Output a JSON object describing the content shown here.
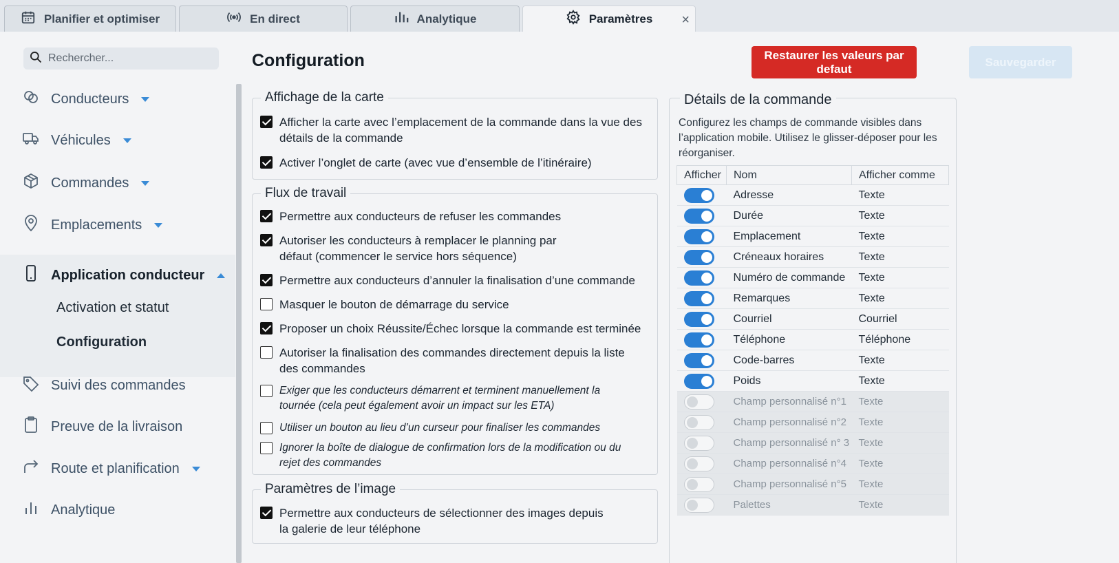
{
  "tabs": [
    {
      "label": "Planifier et optimiser",
      "icon": "calendar-icon"
    },
    {
      "label": "En direct",
      "icon": "broadcast-icon"
    },
    {
      "label": "Analytique",
      "icon": "bar-chart-icon"
    },
    {
      "label": "Paramètres",
      "icon": "gear-icon",
      "active": true
    }
  ],
  "tab_close": "×",
  "search": {
    "placeholder": "Rechercher..."
  },
  "sidebar": {
    "items": [
      {
        "label": "Conducteurs",
        "icon": "drivers-icon"
      },
      {
        "label": "Véhicules",
        "icon": "truck-icon"
      },
      {
        "label": "Commandes",
        "icon": "package-icon"
      },
      {
        "label": "Emplacements",
        "icon": "location-pin-icon"
      },
      {
        "label": "Application conducteur",
        "icon": "mobile-phone-icon"
      },
      {
        "label": "Suivi des commandes",
        "icon": "tag-icon"
      },
      {
        "label": "Preuve de la livraison",
        "icon": "clipboard-icon"
      },
      {
        "label": "Route et planification",
        "icon": "route-arrow-icon"
      },
      {
        "label": "Analytique",
        "icon": "analytics-icon"
      }
    ],
    "subitems": [
      {
        "label": "Activation et statut"
      },
      {
        "label": "Configuration",
        "active": true
      }
    ]
  },
  "page": {
    "title": "Configuration",
    "reset_label": "Restaurer les valeurs par defaut",
    "save_label": "Sauvegarder"
  },
  "map_display": {
    "legend": "Affichage de la carte",
    "options": [
      {
        "label": "Afficher la carte avec l’emplacement de la commande dans la vue des détails de la commande",
        "checked": true
      },
      {
        "label": "Activer l’onglet de carte (avec vue d’ensemble de l’itinéraire)",
        "checked": true
      }
    ]
  },
  "workflow": {
    "legend": "Flux de travail",
    "options": [
      {
        "label": "Permettre aux conducteurs de refuser les commandes",
        "checked": true
      },
      {
        "label": "Autoriser les conducteurs à remplacer le planning par défaut (commencer le service hors séquence)",
        "checked": true
      },
      {
        "label": "Permettre aux conducteurs d’annuler la finalisation d’une commande",
        "checked": true
      },
      {
        "label": "Masquer le bouton de démarrage du service",
        "checked": false
      },
      {
        "label": "Proposer un choix Réussite/Échec lorsque la commande est terminée",
        "checked": true
      },
      {
        "label": "Autoriser la finalisation des commandes directement depuis la liste des commandes",
        "checked": false
      },
      {
        "label": "Exiger que les conducteurs démarrent et terminent manuellement la tournée (cela peut également avoir un impact sur les ETA)",
        "checked": false
      },
      {
        "label": "Utiliser un bouton au lieu d’un curseur pour finaliser les commandes",
        "checked": false
      },
      {
        "label": "Ignorer la boîte de dialogue de confirmation lors de la modification ou du rejet des commandes",
        "checked": false
      }
    ]
  },
  "image_settings": {
    "legend": "Paramètres de l’image",
    "options": [
      {
        "label": "Permettre aux conducteurs de sélectionner des images depuis la galerie de leur téléphone",
        "checked": true
      }
    ]
  },
  "order_details": {
    "title": "Détails de la commande",
    "description": "Configurez les champs de commande visibles dans l’application mobile. Utilisez le glisser-déposer pour les réorganiser.",
    "columns": [
      "Afficher",
      "Nom",
      "Afficher comme"
    ],
    "rows": [
      {
        "show": true,
        "name": "Adresse",
        "as": "Texte"
      },
      {
        "show": true,
        "name": "Durée",
        "as": "Texte"
      },
      {
        "show": true,
        "name": "Emplacement",
        "as": "Texte"
      },
      {
        "show": true,
        "name": "Créneaux horaires",
        "as": "Texte"
      },
      {
        "show": true,
        "name": "Numéro de commande",
        "as": "Texte"
      },
      {
        "show": true,
        "name": "Remarques",
        "as": "Texte"
      },
      {
        "show": true,
        "name": "Courriel",
        "as": "Courriel"
      },
      {
        "show": true,
        "name": "Téléphone",
        "as": "Téléphone"
      },
      {
        "show": true,
        "name": "Code-barres",
        "as": "Texte"
      },
      {
        "show": true,
        "name": "Poids",
        "as": "Texte"
      },
      {
        "show": false,
        "name": "Champ personnalisé n°1",
        "as": "Texte"
      },
      {
        "show": false,
        "name": "Champ personnalisé n°2",
        "as": "Texte"
      },
      {
        "show": false,
        "name": "Champ personnalisé n° 3",
        "as": "Texte"
      },
      {
        "show": false,
        "name": "Champ personnalisé n°4",
        "as": "Texte"
      },
      {
        "show": false,
        "name": "Champ personnalisé n°5",
        "as": "Texte"
      },
      {
        "show": false,
        "name": "Palettes",
        "as": "Texte"
      }
    ]
  },
  "colors": {
    "accent": "#2a7fd4",
    "danger": "#d52a25",
    "disabled_save": "#d7e6f3"
  }
}
